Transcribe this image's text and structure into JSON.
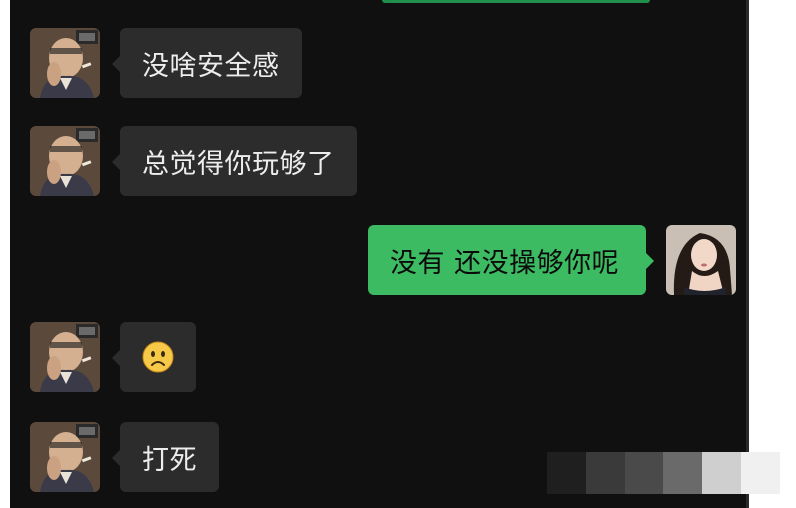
{
  "messages": [
    {
      "side": "left",
      "sender": "friend",
      "text": "没啥安全感"
    },
    {
      "side": "left",
      "sender": "friend",
      "text": "总觉得你玩够了"
    },
    {
      "side": "right",
      "sender": "me",
      "text": "没有 还没操够你呢"
    },
    {
      "side": "left",
      "sender": "friend",
      "emoji": "frowning-face"
    },
    {
      "side": "left",
      "sender": "friend",
      "text": "打死"
    }
  ],
  "colors": {
    "chat_background": "#101010",
    "incoming_bubble": "#2c2c2c",
    "incoming_text": "#ededed",
    "outgoing_bubble": "#3dbb63",
    "outgoing_text": "#0b0b0b"
  },
  "icons": {
    "friend_avatar": "old-man-with-cigar-avatar",
    "my_avatar": "woman-portrait-avatar",
    "emoji": "frowning-face-emoji"
  }
}
